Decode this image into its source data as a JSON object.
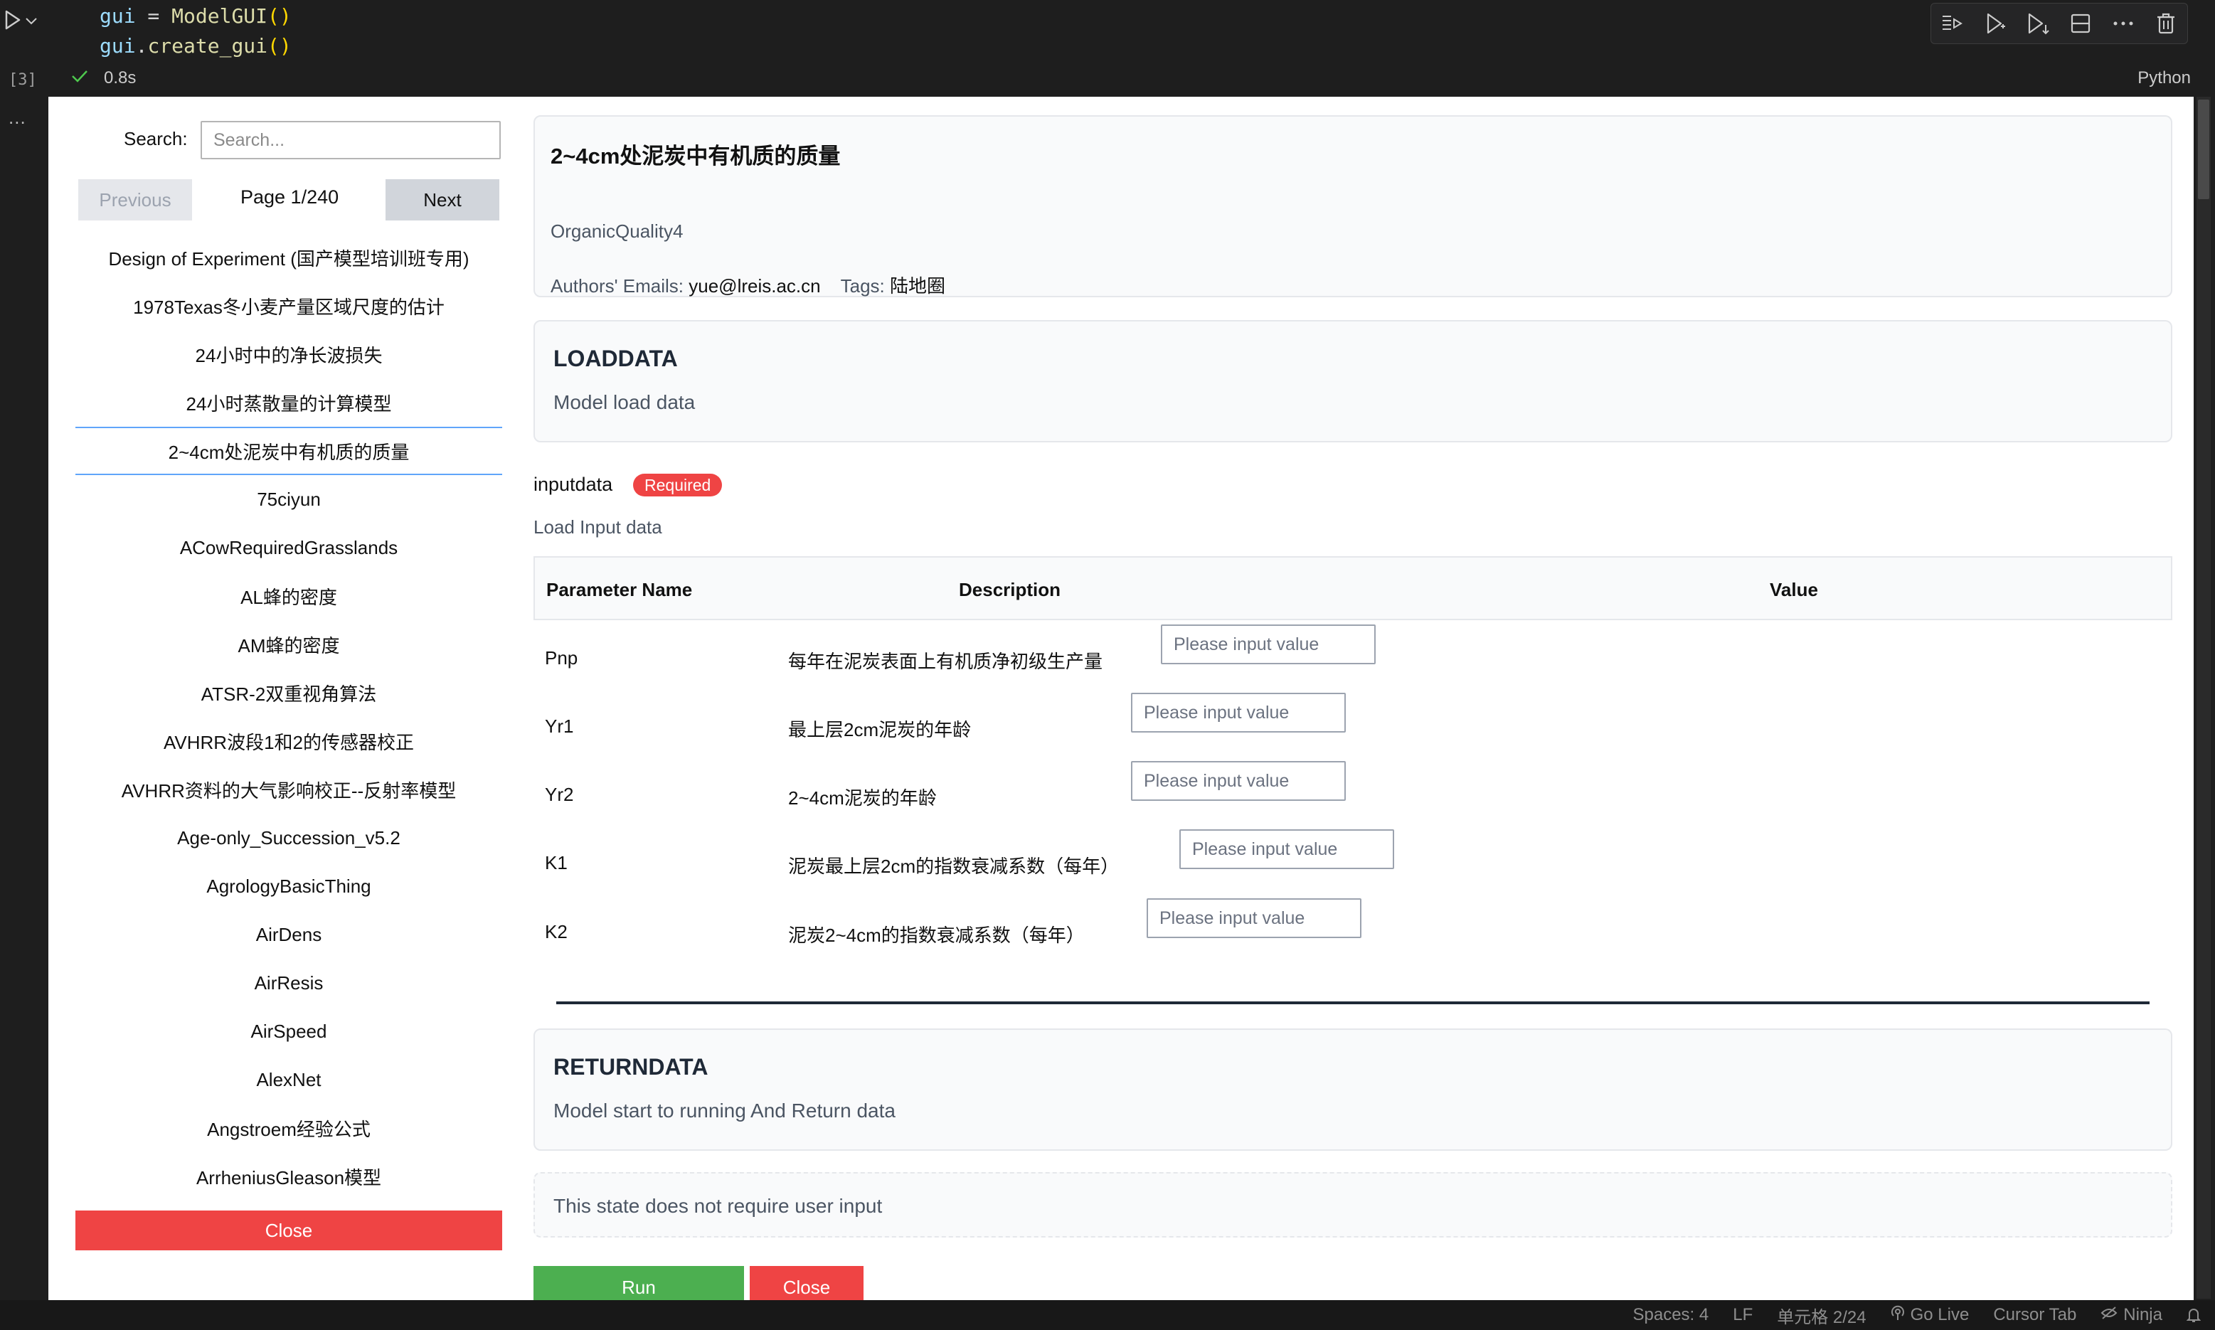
{
  "editor": {
    "code_line1": {
      "var": "gui",
      "op": " = ",
      "cls": "ModelGUI",
      "paren": "()"
    },
    "code_line2": {
      "var": "gui",
      "dot": ".",
      "fn": "create_gui",
      "paren": "()"
    },
    "execution_count": "[3]",
    "more": "...",
    "exec_time": "0.8s",
    "language": "Python",
    "toolbar_icons": [
      "run-by-line-icon",
      "execute-above-icon",
      "execute-below-icon",
      "split-cell-icon",
      "more-icon",
      "delete-icon"
    ]
  },
  "status_bar": {
    "spaces": "Spaces: 4",
    "eol": "LF",
    "cell_position": "单元格 2/24",
    "go_live": "Go Live",
    "cursor_tab": "Cursor Tab",
    "ninja": "Ninja"
  },
  "sidebar": {
    "search_label": "Search:",
    "search_placeholder": "Search...",
    "prev_label": "Previous",
    "page_indicator": "Page 1/240",
    "next_label": "Next",
    "models": [
      "Design of Experiment (国产模型培训班专用)",
      "1978Texas冬小麦产量区域尺度的估计",
      "24小时中的净长波损失",
      "24小时蒸散量的计算模型",
      "2~4cm处泥炭中有机质的质量",
      "75ciyun",
      "ACowRequiredGrasslands",
      "AL蜂的密度",
      "AM蜂的密度",
      "ATSR-2双重视角算法",
      "AVHRR波段1和2的传感器校正",
      "AVHRR资料的大气影响校正--反射率模型",
      "Age-only_Succession_v5.2",
      "AgrologyBasicThing",
      "AirDens",
      "AirResis",
      "AirSpeed",
      "AlexNet",
      "Angstroem经验公式",
      "ArrheniusGleason模型"
    ],
    "selected_index": 4,
    "close_label": "Close"
  },
  "model": {
    "title": "2~4cm处泥炭中有机质的质量",
    "id": "OrganicQuality4",
    "emails_label": "Authors' Emails:",
    "email": "yue@lreis.ac.cn",
    "tags_label": "Tags:",
    "tags": "陆地圈"
  },
  "load_state": {
    "title": "LOADDATA",
    "description": "Model load data"
  },
  "input": {
    "name": "inputdata",
    "badge": "Required",
    "description": "Load Input data",
    "headers": {
      "name": "Parameter Name",
      "description": "Description",
      "value": "Value"
    },
    "placeholder": "Please input value",
    "params": [
      {
        "name": "Pnp",
        "description": "每年在泥炭表面上有机质净初级生产量"
      },
      {
        "name": "Yr1",
        "description": "最上层2cm泥炭的年龄"
      },
      {
        "name": "Yr2",
        "description": "2~4cm泥炭的年龄"
      },
      {
        "name": "K1",
        "description": "泥炭最上层2cm的指数衰减系数（每年）"
      },
      {
        "name": "K2",
        "description": "泥炭2~4cm的指数衰减系数（每年）"
      }
    ]
  },
  "return_state": {
    "title": "RETURNDATA",
    "description": "Model start to running And Return data",
    "note": "This state does not require user input"
  },
  "actions": {
    "run_label": "Run",
    "close_label": "Close"
  },
  "colors": {
    "danger": "#ef4444",
    "success": "#4caf50",
    "selected_border": "#60a5fa"
  }
}
